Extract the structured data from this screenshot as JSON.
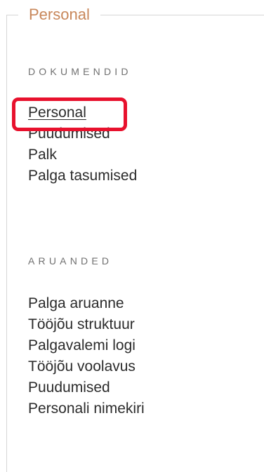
{
  "panel": {
    "legend": "Personal"
  },
  "documents": {
    "heading": "DOKUMENDID",
    "items": [
      {
        "label": "Personal",
        "active": true
      },
      {
        "label": "Puudumised"
      },
      {
        "label": "Palk"
      },
      {
        "label": "Palga tasumised"
      }
    ]
  },
  "reports": {
    "heading": "ARUANDED",
    "items": [
      {
        "label": "Palga aruanne"
      },
      {
        "label": "Tööjõu struktuur"
      },
      {
        "label": "Palgavalemi logi"
      },
      {
        "label": "Tööjõu voolavus"
      },
      {
        "label": "Puudumised"
      },
      {
        "label": "Personali nimekiri"
      }
    ]
  },
  "colors": {
    "legend": "#c8875a",
    "highlight": "#e8112d",
    "text": "#2b2b2b",
    "heading": "#707070",
    "border": "#d6d6d6"
  }
}
